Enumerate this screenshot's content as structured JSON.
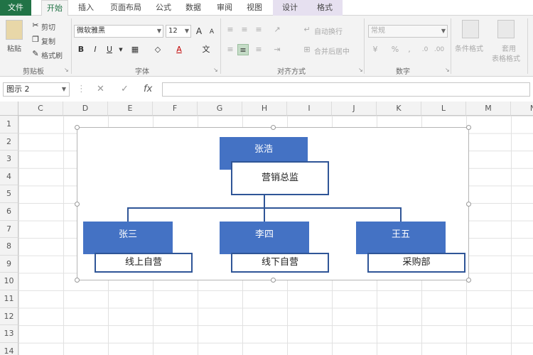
{
  "ribbon_tabs": [
    "文件",
    "开始",
    "插入",
    "页面布局",
    "公式",
    "数据",
    "审阅",
    "视图",
    "设计",
    "格式"
  ],
  "clipboard": {
    "paste": "粘贴",
    "cut": "剪切",
    "copy": "复制",
    "painter": "格式刷",
    "label": "剪贴板"
  },
  "font": {
    "name": "微软雅黑",
    "size": "12",
    "label": "字体",
    "bold": "B",
    "italic": "I",
    "underline": "U",
    "grow": "A",
    "shrink": "A",
    "color_letter": "A",
    "pinyin": "文"
  },
  "alignment": {
    "wrap": "自动换行",
    "merge": "合并后居中",
    "label": "对齐方式"
  },
  "number": {
    "format": "常规",
    "percent": "%",
    "comma": ",",
    "label": "数字"
  },
  "styles": {
    "conditional": "条件格式",
    "table_format_1": "套用",
    "table_format_2": "表格格式"
  },
  "formula_bar": {
    "name_box": "图示 2",
    "cancel": "✕",
    "enter": "✓",
    "fx": "fx",
    "value": ""
  },
  "columns": [
    "C",
    "D",
    "E",
    "F",
    "G",
    "H",
    "I",
    "J",
    "K",
    "L",
    "M",
    "N"
  ],
  "rows": [
    "1",
    "2",
    "3",
    "4",
    "5",
    "6",
    "7",
    "8",
    "9",
    "10",
    "11",
    "12",
    "13",
    "14"
  ],
  "org_chart": {
    "top": {
      "name": "张浩",
      "title": "营销总监"
    },
    "children": [
      {
        "name": "张三",
        "title": "线上自营"
      },
      {
        "name": "李四",
        "title": "线下自营"
      },
      {
        "name": "王五",
        "title": "采购部"
      }
    ]
  },
  "colors": {
    "excel_green": "#217346",
    "node_fill": "#4472c4",
    "node_border": "#2f5597"
  }
}
